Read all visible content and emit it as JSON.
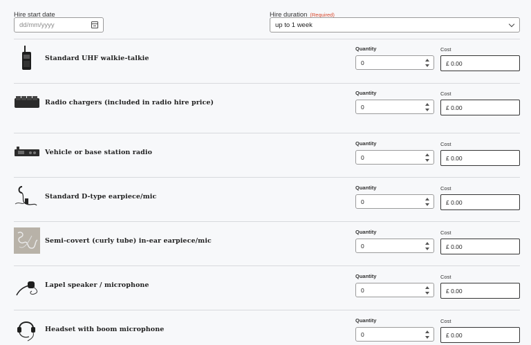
{
  "form": {
    "start_date_label": "Hire start date",
    "start_date_placeholder": "dd/mm/yyyy",
    "duration_label": "Hire duration",
    "duration_required": "(Required)",
    "duration_value": "up to 1 week"
  },
  "labels": {
    "quantity": "Quantity",
    "cost": "Cost"
  },
  "items": [
    {
      "name": "Standard UHF walkie-talkie",
      "quantity": "0",
      "cost": "£ 0.00",
      "icon": "walkie-talkie-icon"
    },
    {
      "name": "Radio chargers (included in radio hire price)",
      "quantity": "0",
      "cost": "£ 0.00",
      "icon": "charger-icon"
    },
    {
      "name": "Vehicle or base station radio",
      "quantity": "0",
      "cost": "£ 0.00",
      "icon": "base-station-icon"
    },
    {
      "name": "Standard D-type earpiece/mic",
      "quantity": "0",
      "cost": "£ 0.00",
      "icon": "earpiece-icon"
    },
    {
      "name": "Semi-covert (curly tube) in-ear earpiece/mic",
      "quantity": "0",
      "cost": "£ 0.00",
      "icon": "curly-tube-icon"
    },
    {
      "name": "Lapel speaker / microphone",
      "quantity": "0",
      "cost": "£ 0.00",
      "icon": "lapel-mic-icon"
    },
    {
      "name": "Headset with boom microphone",
      "quantity": "0",
      "cost": "£ 0.00",
      "icon": "headset-icon"
    }
  ]
}
